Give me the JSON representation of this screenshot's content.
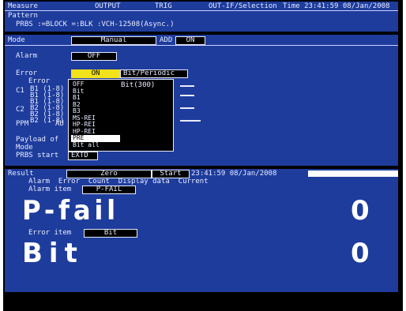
{
  "colors": {
    "panel_bg": "#1e3c9c",
    "screen_bg": "#000000",
    "text": "#e8ecff",
    "highlight": "#f2e21a",
    "selected": "#ffffff"
  },
  "header": {
    "items": [
      "Measure",
      "OUTPUT",
      "TRIG",
      "OUT-IF/Selection",
      "Time 23:41:59 08/Jan/2008"
    ],
    "pattern_label": "Pattern",
    "pattern_value": "PRBS :=BLOCK =:BLK :VCH-12508(Async.)"
  },
  "setup": {
    "tab_mode_label": "Mode",
    "tab_mode_value": "Manual",
    "tab_add_label": "ADD",
    "tab_add_value": "ON",
    "alarm_label": "Alarm",
    "alarm_value": "OFF",
    "error_label": "Error",
    "error_value": "ON",
    "error_detail_label": "Bit/Periodic",
    "error_sub_label": "Error",
    "c1_label": "C1",
    "c2_label": "C2",
    "ppm_label": "PPM",
    "ppm_au": "AU",
    "payload_label": "Payload of",
    "payload_sub": "Mode",
    "prbs_label": "PRBS start",
    "prbs_value": "EXTD",
    "c1_rows": [
      "B1 (1-8)",
      "B1 (1-8)",
      "B1 (1-8)"
    ],
    "c2_rows": [
      "B2 (1-8)",
      "B2 (1-8)",
      "B2 (1-8)"
    ]
  },
  "dropdown": {
    "items": [
      "OFF",
      "Bit",
      "B1",
      "B2",
      "B3",
      "MS-REI",
      "HP-REI",
      "HP-REI",
      "PRE",
      "Bit all"
    ],
    "item_right": "Bit(300)",
    "selected_index": 8
  },
  "result": {
    "result_label": "Result",
    "result_value": "Zero",
    "start_label": "Start",
    "start_value": "23:41:59 08/Jan/2008",
    "alarm_line": "Alarm  Error  Count  Display data  Current",
    "alarm_item_label": "Alarm item",
    "alarm_item_value": "P-FAIL",
    "main_label": "P-fail",
    "main_value": "0",
    "error_item_label": "Error item",
    "error_item_value": "Bit",
    "sub_label": "Bit",
    "sub_value": "0"
  }
}
